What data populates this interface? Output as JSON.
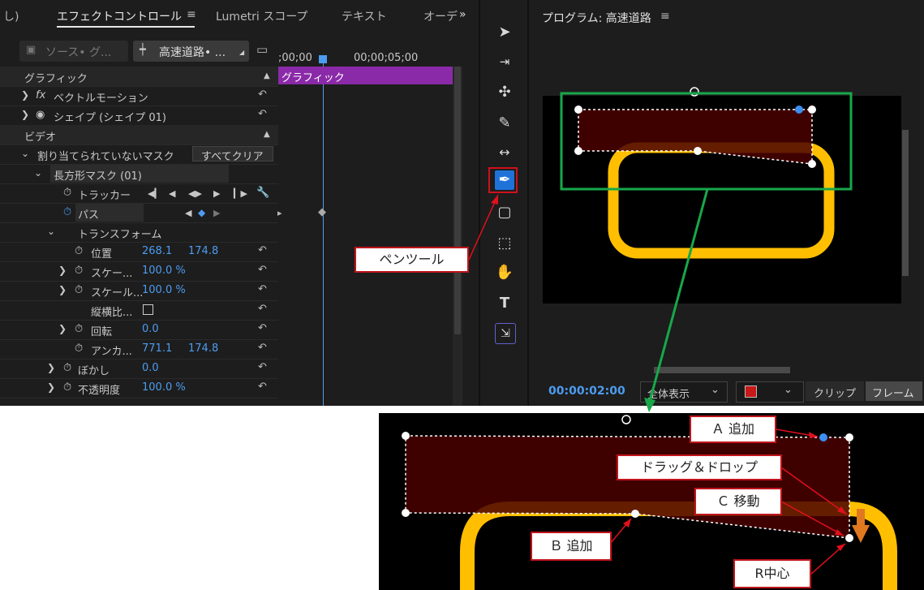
{
  "effect_panel": {
    "tabs": [
      "し)",
      "エフェクトコントロール",
      "Lumetri スコープ",
      "テキスト",
      "オーデ"
    ],
    "more_icon": "double-chevron-right-icon",
    "source_label": "ソース• グ...",
    "clip_label": "高速道路• ...",
    "timecode_start": ";00;00",
    "timecode_mid": "00;00;05;00",
    "clip_bar_label": "グラフィック",
    "sections": {
      "graphic": "グラフィック",
      "vector_motion": "ベクトルモーション",
      "shape": "シェイプ (シェイプ 01)",
      "video": "ビデオ",
      "unassigned_mask": "割り当てられていないマスク",
      "clear_all": "すべてクリア",
      "rect_mask": "長方形マスク (01)",
      "tracker": "トラッカー",
      "path": "パス",
      "transform": "トランスフォーム",
      "position": "位置",
      "position_x": "268.1",
      "position_y": "174.8",
      "scale": "スケー...",
      "scale_val": "100.0 %",
      "scale2": "スケール...",
      "scale2_val": "100.0 %",
      "aspect": "縦横比...",
      "rotation": "回転",
      "rotation_val": "0.0",
      "anchor": "アンカ...",
      "anchor_x": "771.1",
      "anchor_y": "174.8",
      "blur": "ぼかし",
      "blur_val": "0.0",
      "opacity": "不透明度",
      "opacity_val": "100.0 %",
      "fx": "fx"
    }
  },
  "program_monitor": {
    "title": "プログラム: 高速道路",
    "timecode": "00:00:02:00",
    "zoom": "全体表示",
    "clip_btn": "クリップ",
    "frame_btn": "フレーム"
  },
  "tools": [
    "selection-icon",
    "track-select-icon",
    "ripple-edit-icon",
    "razor-icon",
    "slip-icon",
    "pen-icon",
    "rectangle-icon",
    "marquee-icon",
    "hand-icon",
    "type-icon",
    "remix-icon"
  ],
  "callouts": {
    "pen_tool": "ペンツール",
    "a_add": "Ａ 追加",
    "drag_drop": "ドラッグ＆ドロップ",
    "c_move": "Ｃ 移動",
    "b_add": "Ｂ 追加",
    "r_center": "R中心"
  },
  "colors": {
    "panel_bg": "#1d1d1d",
    "accent_blue": "#4c9cf0",
    "clip_purple": "#8a2aa8",
    "callout_red": "#c0141c",
    "highlight_green": "#17a84a",
    "shape_orange": "#ffbf00",
    "mask_fill": "#4a0000"
  }
}
